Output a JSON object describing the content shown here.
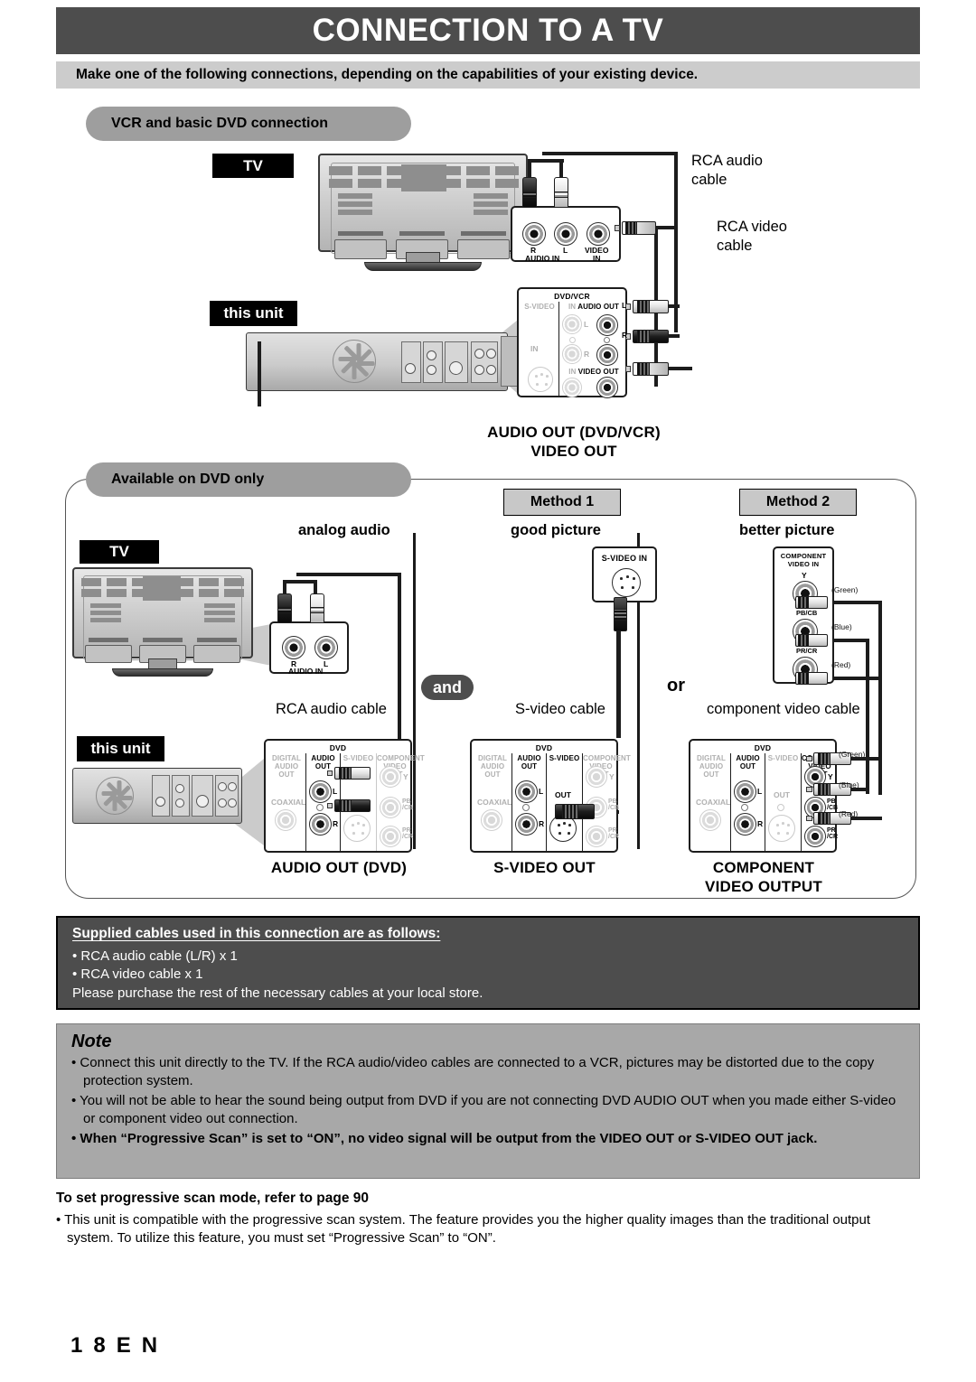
{
  "header": {
    "title": "CONNECTION TO A TV",
    "subtitle": "Make one of the following connections, depending on the capabilities of your existing device."
  },
  "section_vcr": {
    "pill_label": "VCR and basic DVD connection",
    "tv_tag": "TV",
    "unit_tag": "this unit",
    "cable_rca_audio": "RCA audio\ncable",
    "cable_rca_video": "RCA video\ncable",
    "tv_panel": {
      "jack_r": "R",
      "jack_l": "L",
      "jack_video": "VIDEO",
      "label_audio_in": "AUDIO IN",
      "label_in": "IN"
    },
    "unit_panel": {
      "title": "DVD/VCR",
      "col_svideo": "S-VIDEO",
      "row_audio": "IN — AUDIO — OUT",
      "row_audio_in": "IN",
      "row_audio_mid": "AUDIO",
      "row_audio_out": "OUT",
      "row_video_in": "IN",
      "row_video_mid": "VIDEO",
      "row_video_out": "OUT",
      "jack_l": "L",
      "jack_r": "R",
      "svideo_in": "IN",
      "plug_l": "L",
      "plug_r": "R"
    },
    "caption_line1": "AUDIO OUT (DVD/VCR)",
    "caption_line2": "VIDEO OUT"
  },
  "section_dvd": {
    "pill_label": "Available on DVD only",
    "tv_tag": "TV",
    "unit_tag": "this unit",
    "col_analog": {
      "heading": "analog audio",
      "cable_label": "RCA audio cable",
      "caption": "AUDIO OUT (DVD)",
      "tv_panel": {
        "jack_r": "R",
        "jack_l": "L",
        "label_audio_in": "AUDIO IN"
      }
    },
    "col_method1": {
      "method_label": "Method 1",
      "quality": "good picture",
      "tv_jack_label": "S-VIDEO IN",
      "cable_label": "S-video cable",
      "caption": "S-VIDEO OUT"
    },
    "col_method2": {
      "method_label": "Method 2",
      "quality": "better picture",
      "tv_jack_label_1": "COMPONENT",
      "tv_jack_label_2": "VIDEO IN",
      "cable_label": "component video cable",
      "caption_line1": "COMPONENT",
      "caption_line2": "VIDEO OUTPUT",
      "jacks": [
        {
          "name": "Y",
          "color": "(Green)"
        },
        {
          "name": "PB/CB",
          "color": "(Blue)"
        },
        {
          "name": "PR/CR",
          "color": "(Red)"
        }
      ]
    },
    "badge_and": "and",
    "badge_or": "or",
    "dvd_panel": {
      "title": "DVD",
      "col1_l1": "DIGITAL",
      "col1_l2": "AUDIO OUT",
      "col1_coaxial": "COAXIAL",
      "col2_l1": "AUDIO",
      "col2_l2": "OUT",
      "col2_jack_l": "L",
      "col2_jack_r": "R",
      "col3": "S-VIDEO",
      "col3_out": "OUT",
      "col4_l1": "COMPONENT",
      "col4_l2": "VIDEO OUT",
      "col4_y": "Y",
      "col4_pb": "PB",
      "col4_pb2": "/CB",
      "col4_pr": "PR",
      "col4_pr2": "/CR"
    }
  },
  "supplied": {
    "heading": "Supplied cables used in this connection are as follows:",
    "items": [
      "• RCA audio cable (L/R) x 1",
      "• RCA video cable x 1"
    ],
    "footer": "Please purchase the rest of the necessary cables at your local store."
  },
  "note": {
    "heading": "Note",
    "items": [
      {
        "text": "• Connect this unit directly to the TV. If the RCA audio/video cables are connected to a VCR, pictures may be distorted due to the copy protection system.",
        "bold": false
      },
      {
        "text": "• You will not be able to hear the sound being output from DVD if you are not connecting DVD AUDIO OUT when you made either S-video or component video out connection.",
        "bold": false
      },
      {
        "text": "• When “Progressive Scan” is set to “ON”, no video signal will be output from the VIDEO OUT or S-VIDEO OUT jack.",
        "bold": true
      }
    ]
  },
  "progressive": {
    "heading": "To set progressive scan mode, refer to page 90",
    "body": "• This unit is compatible with the progressive scan system. The feature provides you the higher quality images than the traditional output system. To utilize this feature, you must set “Progressive Scan” to “ON”."
  },
  "footer": {
    "page": "18",
    "lang": "EN"
  },
  "colors": {
    "title_bar": "#4d4d4d",
    "subtitle_bar": "#cccccc",
    "pill": "#9e9e9e",
    "note_bg": "#a8a8a8",
    "supplied_bg": "#4d4d4d",
    "method_bg": "#c8c8c8"
  }
}
